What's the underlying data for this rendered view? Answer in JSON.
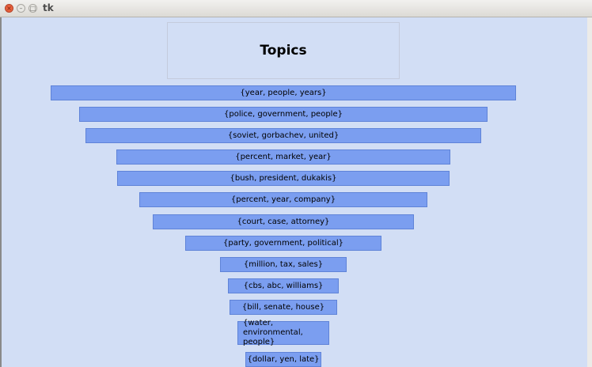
{
  "window": {
    "title": "tk",
    "close_glyph": "×",
    "min_glyph": "–",
    "max_glyph": "□"
  },
  "chart": {
    "title": "Topics"
  },
  "topics": [
    "{year, people, years}",
    "{police, government, people}",
    "{soviet, gorbachev, united}",
    "{percent, market, year}",
    "{bush, president, dukakis}",
    "{percent, year, company}",
    "{court, case, attorney}",
    "{party, government, political}",
    "{million, tax, sales}",
    "{cbs, abc, williams}",
    "{bill, senate, house}",
    "{water, environmental, people}",
    "{dollar, yen, late}"
  ],
  "colors": {
    "bar_fill": "#7b9ef0",
    "canvas_bg": "#d2def5"
  }
}
